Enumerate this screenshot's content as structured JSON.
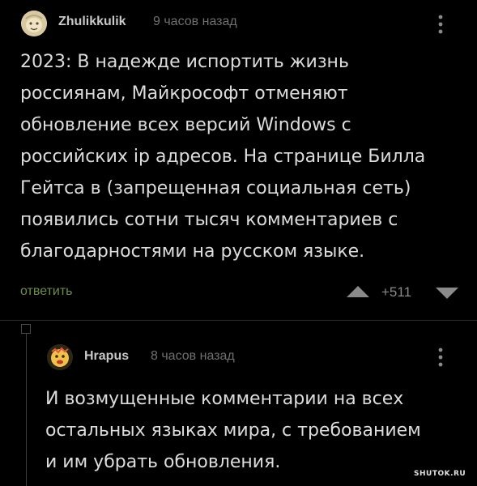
{
  "colors": {
    "background": "#000000",
    "text": "#dcdcdc",
    "author": "#c8c8c8",
    "muted": "#707070",
    "reply_link": "#6b8e4e",
    "vote": "#8a8a8a"
  },
  "comment": {
    "author": "Zhulikkulik",
    "time": "9 часов назад",
    "text": "2023: В надежде испортить жизнь\nроссиянам, Майкрософт отменяют\nобновление всех версий Windows с\nроссийских ip адресов. На странице Билла\nГейтса в (запрещенная социальная сеть)\nпоявились сотни тысяч комментариев с\nблагодарностями на русском языке.",
    "reply_label": "ответить",
    "rating": "+511",
    "icons": {
      "avatar": "avatar-icon",
      "menu": "more-vertical-icon",
      "vote_up": "triangle-up-icon",
      "vote_down": "triangle-down-icon"
    }
  },
  "reply": {
    "author": "Hrapus",
    "time": "8 часов назад",
    "text": "И возмущенные комментарии на всех\nостальных языках мира, с требованием\nи им убрать обновления.",
    "icons": {
      "avatar": "avatar-icon",
      "menu": "more-vertical-icon",
      "thread_toggle": "collapse-thread-icon"
    }
  },
  "watermark": "SHUTOK.RU"
}
